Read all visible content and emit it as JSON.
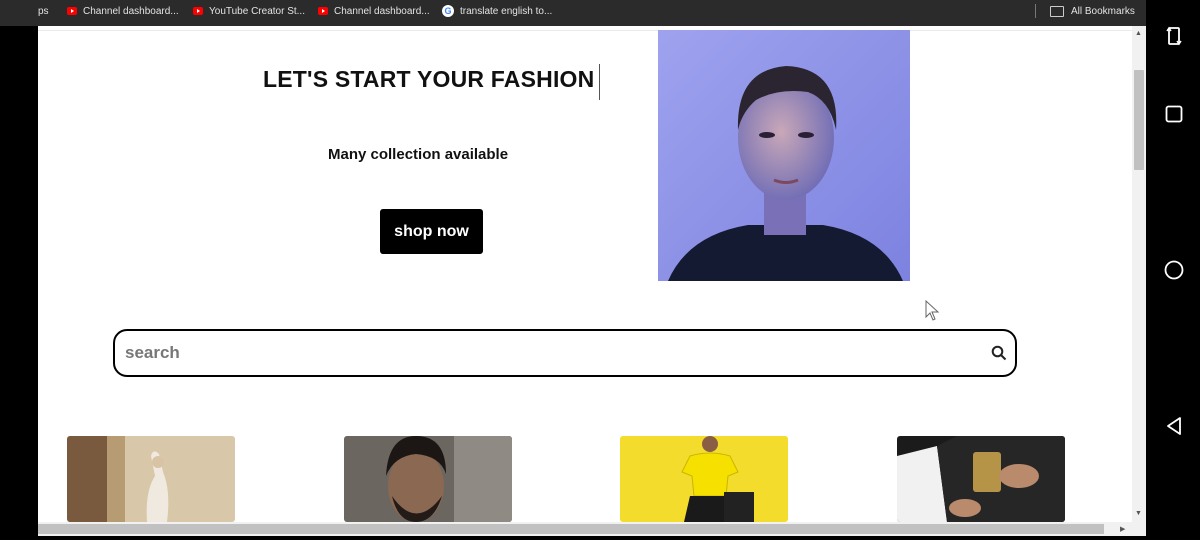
{
  "bookmarks": {
    "items": [
      {
        "label": "ps",
        "icon": "apps-icon"
      },
      {
        "label": "Channel dashboard...",
        "icon": "youtube-icon"
      },
      {
        "label": "YouTube Creator St...",
        "icon": "youtube-icon"
      },
      {
        "label": "Channel dashboard...",
        "icon": "youtube-icon"
      },
      {
        "label": "translate english to...",
        "icon": "google-icon"
      }
    ],
    "all_bookmarks": "All Bookmarks"
  },
  "hero": {
    "title": "LET'S START YOUR FASHION",
    "subtitle": "Many collection available",
    "shop_button": "shop now"
  },
  "search": {
    "placeholder": "search"
  },
  "products": [
    {
      "icon": "woman-dancer-photo"
    },
    {
      "icon": "bearded-man-photo"
    },
    {
      "icon": "yellow-shirt-man-photo"
    },
    {
      "icon": "man-with-whiskey-photo"
    }
  ],
  "colors": {
    "bookmark_bar": "#2b2b2b",
    "button_bg": "#000000",
    "portrait_bg": "#8a8fe6"
  }
}
